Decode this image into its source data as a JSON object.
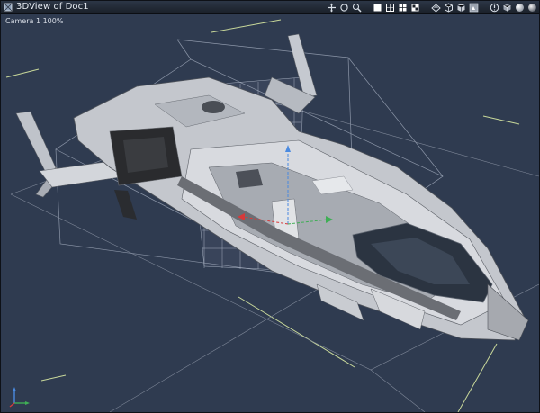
{
  "window": {
    "title": "3DView of Doc1",
    "camera_label": "Camera 1 100%"
  },
  "toolbar": {
    "icons": [
      "move-view-icon",
      "rotate-view-icon",
      "zoom-view-icon",
      "white-box-icon",
      "wireframe-icon",
      "hidden-line-icon",
      "flat-shade-icon",
      "smooth-shade-icon",
      "texture-shade-icon",
      "light-preview-icon",
      "render-area-icon",
      "render-settings-icon",
      "sphere-preview-icon"
    ]
  },
  "colors": {
    "viewport_bg": "#2f3b50",
    "guide_line": "#c8d89a",
    "grid_line": "#7f8899",
    "hull_light": "#c9ccd2",
    "hull_dark": "#6c6f75"
  }
}
